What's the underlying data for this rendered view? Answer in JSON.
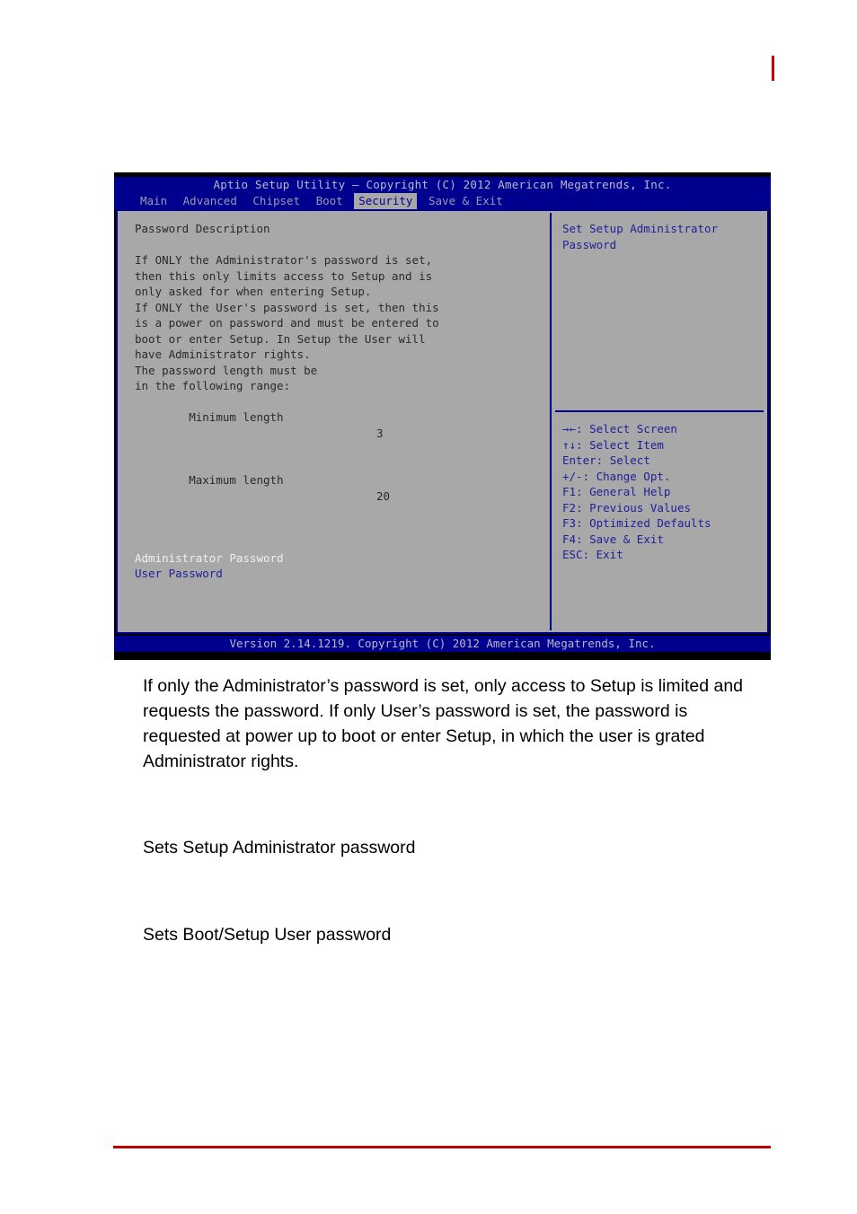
{
  "page": {
    "red_tick": "#cc0000",
    "red_rule_color": "#c00000"
  },
  "bios": {
    "title": "Aptio Setup Utility – Copyright (C) 2012 American Megatrends, Inc.",
    "footer": "Version 2.14.1219. Copyright (C) 2012 American Megatrends, Inc.",
    "tabs": [
      {
        "label": "Main",
        "active": false
      },
      {
        "label": "Advanced",
        "active": false
      },
      {
        "label": "Chipset",
        "active": false
      },
      {
        "label": "Boot",
        "active": false
      },
      {
        "label": "Security",
        "active": true
      },
      {
        "label": "Save & Exit",
        "active": false
      }
    ],
    "left_panel": {
      "heading": "Password Description",
      "description_lines": [
        "If ONLY the Administrator's password is set,",
        "then this only limits access to Setup and is",
        "only asked for when entering Setup.",
        "If ONLY the User's password is set, then this",
        "is a power on password and must be entered to",
        "boot or enter Setup. In Setup the User will",
        "have Administrator rights.",
        "The password length must be",
        "in the following range:"
      ],
      "length_rows": [
        {
          "label": "Minimum length",
          "value": "3"
        },
        {
          "label": "Maximum length",
          "value": "20"
        }
      ],
      "password_items": [
        {
          "label": "Administrator Password",
          "selected": true
        },
        {
          "label": "User Password",
          "selected": false
        }
      ]
    },
    "right_panel": {
      "help_lines": [
        "Set Setup Administrator",
        "Password"
      ],
      "hotkeys": [
        {
          "key": "→←",
          "action": ": Select Screen"
        },
        {
          "key": "↑↓",
          "action": ": Select Item"
        },
        {
          "key": "Enter",
          "action": ": Select"
        },
        {
          "key": "+/-",
          "action": ": Change Opt."
        },
        {
          "key": "F1",
          "action": ": General Help"
        },
        {
          "key": "F2",
          "action": ": Previous Values"
        },
        {
          "key": "F3",
          "action": ": Optimized Defaults"
        },
        {
          "key": "F4",
          "action": ": Save & Exit"
        },
        {
          "key": "ESC",
          "action": ": Exit"
        }
      ]
    },
    "colors": {
      "title_bar": "#00008f",
      "panel_bg": "#a8a8a8",
      "accent_blue": "#20209a",
      "selected_text": "#f0f0f0"
    }
  },
  "document": {
    "paragraph": "If only the Administrator’s password is set, only access to Setup is limited and requests the password. If only User’s password is set, the password is requested at power up to boot or enter Setup, in which the user is grated Administrator rights.",
    "caption_admin": "Sets Setup Administrator password",
    "caption_user": "Sets Boot/Setup User password"
  }
}
